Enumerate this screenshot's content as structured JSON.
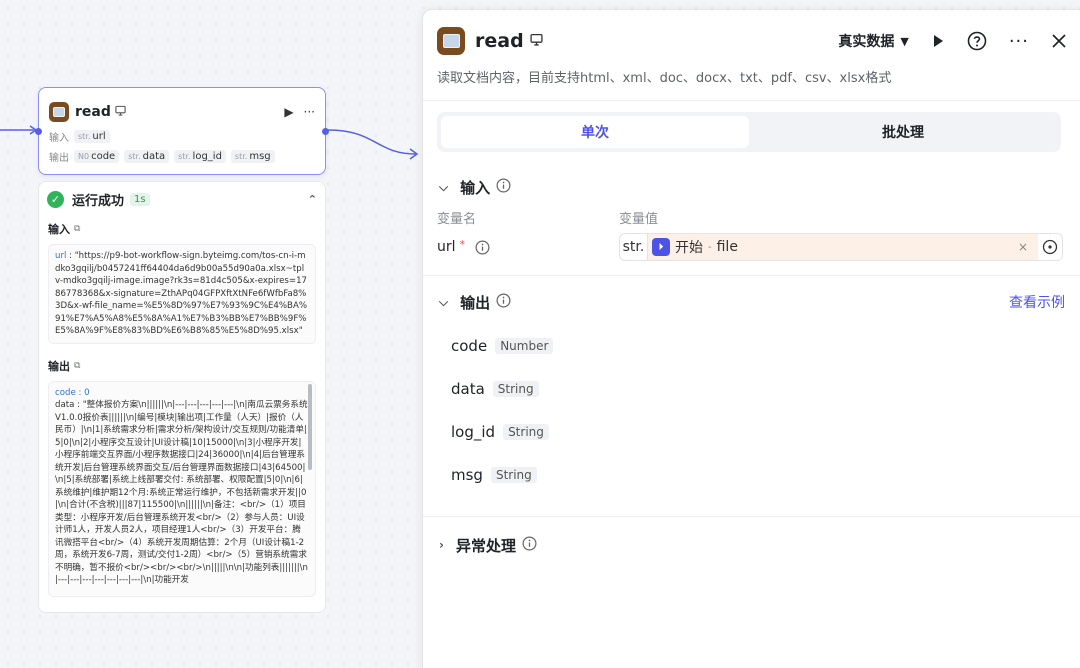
{
  "node": {
    "title": "read",
    "tag_icon": "preview-icon",
    "input_label": "输入",
    "output_label": "输出",
    "input_params": [
      {
        "type": "str.",
        "name": "url"
      }
    ],
    "output_params": [
      {
        "type": "N0",
        "name": "code"
      },
      {
        "type": "str.",
        "name": "data"
      },
      {
        "type": "str.",
        "name": "log_id"
      },
      {
        "type": "str.",
        "name": "msg"
      }
    ]
  },
  "result": {
    "status": "运行成功",
    "duration": "1s",
    "input_label": "输入",
    "output_label": "输出",
    "input_key": "url",
    "input_value": "\"https://p9-bot-workflow-sign.byteimg.com/tos-cn-i-mdko3gqilj/b0457241ff64404da6d9b00a55d90a0a.xlsx~tplv-mdko3gqilj-image.image?rk3s=81d4c505&x-expires=1786778368&x-signature=ZthAPq04GFPXftXtNFe6fWfbFa8%3D&x-wf-file_name=%E5%8D%97%E7%93%9C%E4%BA%91%E7%A5%A8%E5%8A%A1%E7%B3%BB%E7%BB%9F%E5%8A%9F%E8%83%BD%E6%B8%85%E5%8D%95.xlsx\"",
    "code_key": "code",
    "code_value": "0",
    "data_key": "data",
    "data_value": "\"整体报价方案\\n||||||\\n|---|---|---|---|---|\\n|南瓜云票务系统V1.0.0报价表||||||\\n|编号|模块|输出项|工作量（人天）|报价（人民币）|\\n|1|系统需求分析|需求分析/架构设计/交互规则/功能清单|5|0|\\n|2|小程序交互设计|UI设计稿|10|15000|\\n|3|小程序开发|小程序前端交互界面/小程序数据接口|24|36000|\\n|4|后台管理系统开发|后台管理系统界面交互/后台管理界面数据接口|43|64500|\\n|5|系统部署|系统上线部署交付: 系统部署、权限配置|5|0|\\n|6|系统维护|维护期12个月:系统正常运行维护，不包括新需求开发||0|\\n|合计(不含税)|||87|115500|\\n||||||\\n|备注：<br/>（1）项目类型：小程序开发/后台管理系统开发<br/>（2）参与人员：UI设计师1人，开发人员2人，项目经理1人<br/>（3）开发平台：腾讯微搭平台<br/>（4）系统开发周期估算：2个月（UI设计稿1-2周，系统开发6-7周，测试/交付1-2周）<br/>（5）营销系统需求不明确，暂不报价<br/><br/><br/>\\n|||||\\n\\n|功能列表|||||||\\n|---|---|---|---|---|---|---|\\n|功能开发"
  },
  "panel": {
    "title": "read",
    "data_mode": "真实数据",
    "description": "读取文档内容，目前支持html、xml、doc、docx、txt、pdf、csv、xlsx格式",
    "tabs": [
      {
        "label": "单次",
        "active": true
      },
      {
        "label": "批处理",
        "active": false
      }
    ],
    "input_section": {
      "title": "输入",
      "col_name": "变量名",
      "col_value": "变量值",
      "var_name": "url",
      "required_mark": "*",
      "var_type": "str.",
      "ref_source": "开始",
      "ref_sep": "-",
      "ref_field": "file"
    },
    "output_section": {
      "title": "输出",
      "example_link": "查看示例",
      "vars": [
        {
          "name": "code",
          "type": "Number"
        },
        {
          "name": "data",
          "type": "String"
        },
        {
          "name": "log_id",
          "type": "String"
        },
        {
          "name": "msg",
          "type": "String"
        }
      ]
    },
    "error_section": {
      "title": "异常处理"
    }
  },
  "colors": {
    "accent": "#4d53e8",
    "success": "#2fb45a",
    "brand_icon": "#7a4b1f",
    "ref_bg": "#fdf0e6"
  }
}
